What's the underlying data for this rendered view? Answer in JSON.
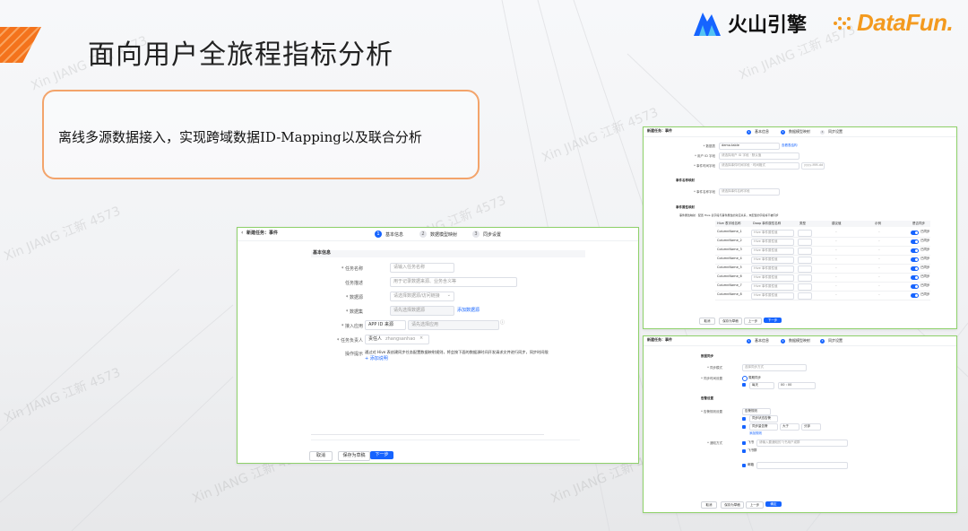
{
  "slide": {
    "title": "面向用户全旅程指标分析",
    "callout": "离线多源数据接入，实现跨域数据ID-Mapping以及联合分析"
  },
  "logos": {
    "volc": "火山引擎",
    "datafun": "DataFun."
  },
  "watermark": "Xin JIANG 江新 4573",
  "colors": {
    "accent": "#1664ff",
    "frame": "#8ed16a",
    "callout_border": "#f3a46b",
    "brand_orange": "#f39a1f"
  },
  "main_form": {
    "header_title": "新建任务：事件",
    "steps": [
      {
        "num": "1",
        "label": "基本信息"
      },
      {
        "num": "2",
        "label": "数据模型映射"
      },
      {
        "num": "3",
        "label": "同步设置"
      }
    ],
    "section_title": "基本信息",
    "fields": {
      "task_name": {
        "label": "* 任务名称",
        "placeholder": "请输入任务名称"
      },
      "task_desc": {
        "label": "任务描述",
        "placeholder": "用于记录数据来源、业务含义等"
      },
      "datasource": {
        "label": "* 数据源",
        "placeholder": "请选择数据源/访问链接"
      },
      "dataset": {
        "label": "* 数据集",
        "placeholder": "请先选择数据源",
        "link": "添加数据源"
      },
      "access_app": {
        "label": "* 接入应用",
        "value": "APP ID 来源",
        "placeholder": "请先选择应用"
      },
      "owner": {
        "label": "* 任务负责人",
        "value": "责任人",
        "tag_sub": "zhangsanhao"
      },
      "tip": {
        "label": "操作提示",
        "text": "通过对 Hive 表创建同步任务配置数据映射规则，将会按下面的数据源时间开发请求文件进行同步，同步时间限",
        "link": "+ 添加说明"
      }
    },
    "buttons": {
      "cancel": "取消",
      "save_draft": "保存为草稿",
      "next": "下一步"
    }
  },
  "mapping_form": {
    "header_title": "新建任务：事件",
    "steps": [
      {
        "num": "1",
        "label": "基本信息"
      },
      {
        "num": "2",
        "label": "数据模型映射"
      },
      {
        "num": "3",
        "label": "同步设置"
      }
    ],
    "rows": [
      {
        "label": "* 数据表",
        "value": "demo.table",
        "link": "查看表结构"
      },
      {
        "label": "* 用户 ID 字段",
        "value": "请选择用户 ID 字段 · 默认值"
      },
      {
        "label": "* 事件时间字段",
        "value": "请选择事件时间字段 · 时间格式",
        "extra": "yyyy-MM-dd"
      }
    ],
    "event_section": "事件名称映射",
    "event_row": {
      "label": "* 事件名称字段",
      "value": "请选择事件名称字段"
    },
    "attr_section": "事件属性映射",
    "attr_hint": "事件属性映射 · 配置 Hive 表字段与事件属性的对应关系，未配置的字段将不被同步",
    "table_headers": [
      "Hive 表字段名称",
      "Doop 事件属性名称",
      "类型",
      "建议值",
      "示例",
      "是否同步"
    ],
    "table_rows": [
      {
        "col": "ColumnName_1",
        "sel": "Hive 事件属性值"
      },
      {
        "col": "ColumnName_2",
        "sel": "Hive 事件属性值"
      },
      {
        "col": "ColumnName_3",
        "sel": "Hive 事件属性值"
      },
      {
        "col": "ColumnName_4",
        "sel": "Hive 事件属性值"
      },
      {
        "col": "ColumnName_5",
        "sel": "Hive 事件属性值"
      },
      {
        "col": "ColumnName_6",
        "sel": "Hive 事件属性值"
      },
      {
        "col": "ColumnName_7",
        "sel": "Hive 事件属性值"
      },
      {
        "col": "ColumnName_8",
        "sel": "Hive 事件属性值"
      }
    ],
    "sync_label": "已同步",
    "buttons": {
      "cancel": "取消",
      "save_draft": "保存为草稿",
      "prev": "上一步",
      "next": "下一步"
    }
  },
  "sync_form": {
    "header_title": "新建任务：事件",
    "steps": [
      {
        "num": "1",
        "label": "基本信息"
      },
      {
        "num": "2",
        "label": "数据模型映射"
      },
      {
        "num": "3",
        "label": "同步设置"
      }
    ],
    "sec1": "数据同步",
    "sync_mode": {
      "label": "* 同步模式",
      "value": "选择同步方式"
    },
    "sync_time": {
      "label": "* 同步时间设置",
      "option": "周期同步",
      "sub": "每天",
      "time": "00 : 00"
    },
    "sec2": "告警设置",
    "alert_rule": {
      "label": "* 告警规则设置",
      "value": "告警规则",
      "r1": "同步状态告警",
      "r2": "同步量告警",
      "r3": "大于",
      "r4": "分钟",
      "link": "添加规则"
    },
    "alert_method": {
      "label": "* 通知方式",
      "m1": "飞书",
      "m2": "飞书群",
      "m3": "邮箱",
      "p": "请输入要通知的飞书用户或群"
    },
    "buttons": {
      "cancel": "取消",
      "save_draft": "保存为草稿",
      "prev": "上一步",
      "finish": "确定"
    }
  }
}
